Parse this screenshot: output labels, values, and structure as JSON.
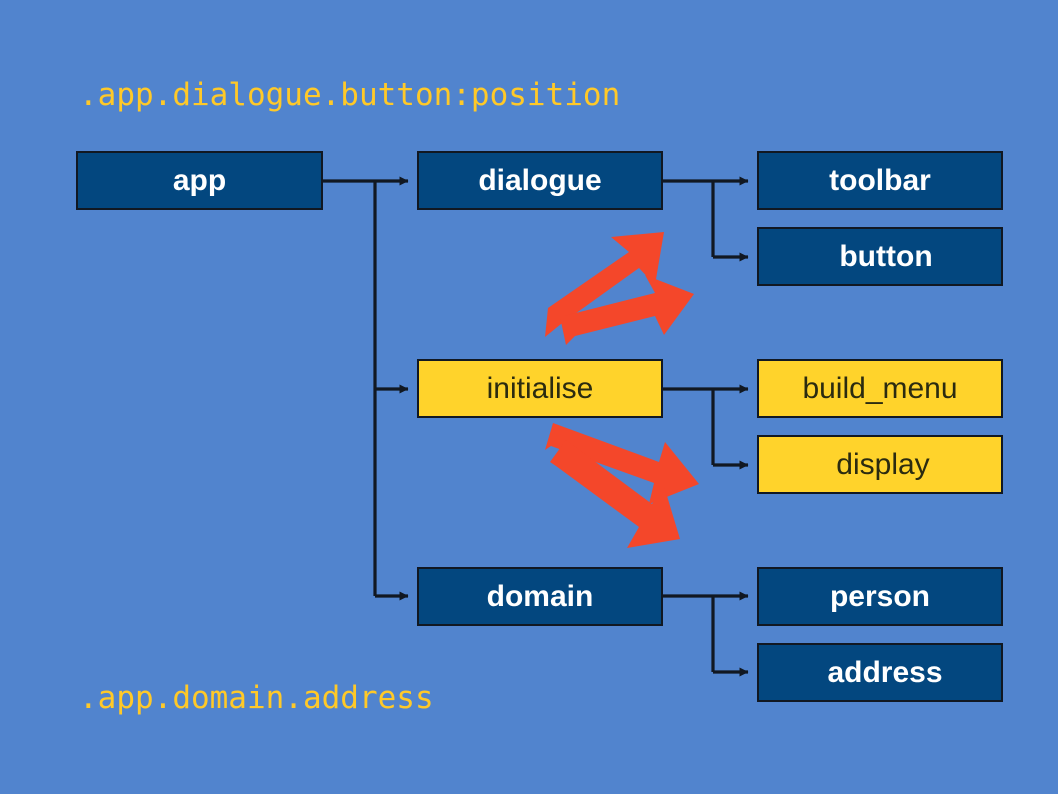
{
  "slide": {
    "background_color": "#5184ce",
    "caption_color": "#ffc928",
    "dark_node_fill": "#03477f",
    "dark_node_text": "#ffffff",
    "light_node_fill": "#ffd32b",
    "light_node_text": "#2b2b10",
    "connector_color": "#111822",
    "highlight_arrow_color": "#f4472a"
  },
  "captions": {
    "top": ".app.dialogue.button:position",
    "bottom": ".app.domain.address"
  },
  "nodes": {
    "app": "app",
    "dialogue": "dialogue",
    "toolbar": "toolbar",
    "button": "button",
    "initialise": "initialise",
    "build_menu": "build_menu",
    "display": "display",
    "domain": "domain",
    "person": "person",
    "address": "address"
  },
  "tree": {
    "root": "app",
    "children": [
      {
        "name": "dialogue",
        "style": "dark",
        "children": [
          {
            "name": "toolbar",
            "style": "dark"
          },
          {
            "name": "button",
            "style": "dark"
          }
        ]
      },
      {
        "name": "initialise",
        "style": "light",
        "children": [
          {
            "name": "build_menu",
            "style": "light"
          },
          {
            "name": "display",
            "style": "light"
          }
        ]
      },
      {
        "name": "domain",
        "style": "dark",
        "children": [
          {
            "name": "person",
            "style": "dark"
          },
          {
            "name": "address",
            "style": "dark"
          }
        ]
      }
    ]
  },
  "highlight_arrows": [
    {
      "name": "upper-double-arrow",
      "direction": "up-right",
      "points_from": "initialise-row",
      "points_to": "button"
    },
    {
      "name": "lower-double-arrow",
      "direction": "down-right",
      "points_from": "initialise-row",
      "points_to": "display"
    }
  ]
}
